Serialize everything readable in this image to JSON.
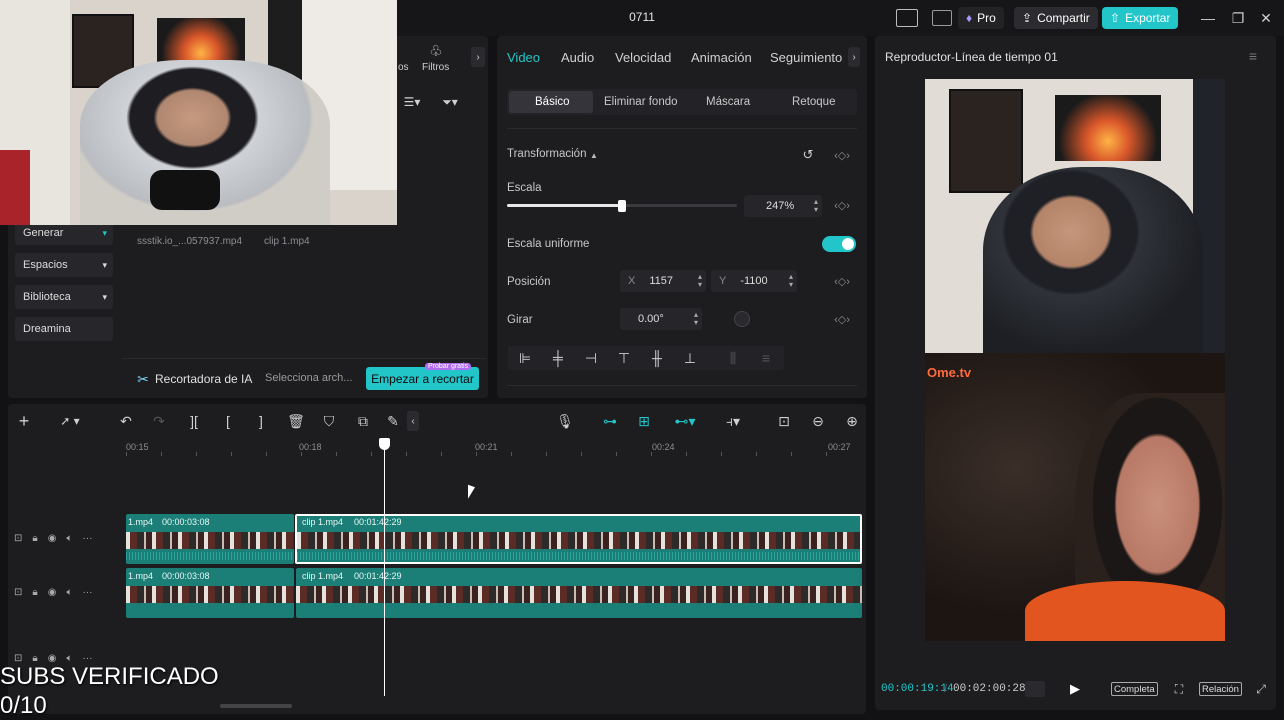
{
  "app": {
    "title": "0711",
    "pro_label": "Pro",
    "share_label": "Compartir",
    "export_label": "Exportar"
  },
  "media": {
    "tabs_partial": "os",
    "filters_label": "Filtros",
    "files": [
      "ssstik.io_...057937.mp4",
      "clip 1.mp4"
    ],
    "sidebar": [
      "Generar",
      "Espacios",
      "Biblioteca",
      "Dreamina"
    ],
    "ai_cutter": {
      "label": "Recortadora de IA",
      "select_text": "Selecciona arch...",
      "start_button": "Empezar a recortar",
      "badge": "Probar gratis"
    }
  },
  "inspector": {
    "tabs": [
      "Video",
      "Audio",
      "Velocidad",
      "Animación",
      "Seguimiento"
    ],
    "active_tab": "Video",
    "subtabs": [
      "Básico",
      "Eliminar fondo",
      "Máscara",
      "Retoque"
    ],
    "section": "Transformación",
    "scale_label": "Escala",
    "scale_value": "247%",
    "scale_fraction": 0.5,
    "uniform_label": "Escala uniforme",
    "uniform_on": true,
    "position_label": "Posición",
    "x_label": "X",
    "x_value": "1157",
    "y_label": "Y",
    "y_value": "-1100",
    "rotate_label": "Girar",
    "rotate_value": "0.00°"
  },
  "player": {
    "title": "Reproductor-Línea de tiempo 01",
    "current_time": "00:00:19:14",
    "total_time": "00:02:00:28",
    "full_label": "Completa",
    "ratio_label": "Relación",
    "watermark": "Ome.tv"
  },
  "timeline": {
    "ruler": [
      "00:15",
      "00:18",
      "00:21",
      "00:24",
      "00:27"
    ],
    "tracks": [
      {
        "clips": [
          {
            "name": "1.mp4",
            "duration": "00:00:03:08"
          },
          {
            "name": "clip 1.mp4",
            "duration": "00:01:42:29"
          }
        ]
      },
      {
        "clips": [
          {
            "name": "1.mp4",
            "duration": "00:00:03:08"
          },
          {
            "name": "clip 1.mp4",
            "duration": "00:01:42:29"
          }
        ]
      }
    ]
  },
  "overlay": {
    "line1": "SUBS VERIFICADO",
    "line2": "0/10"
  },
  "colors": {
    "accent": "#22c6c9",
    "clip": "#1b7f78",
    "pro": "#a995ff",
    "background": "#121214"
  }
}
